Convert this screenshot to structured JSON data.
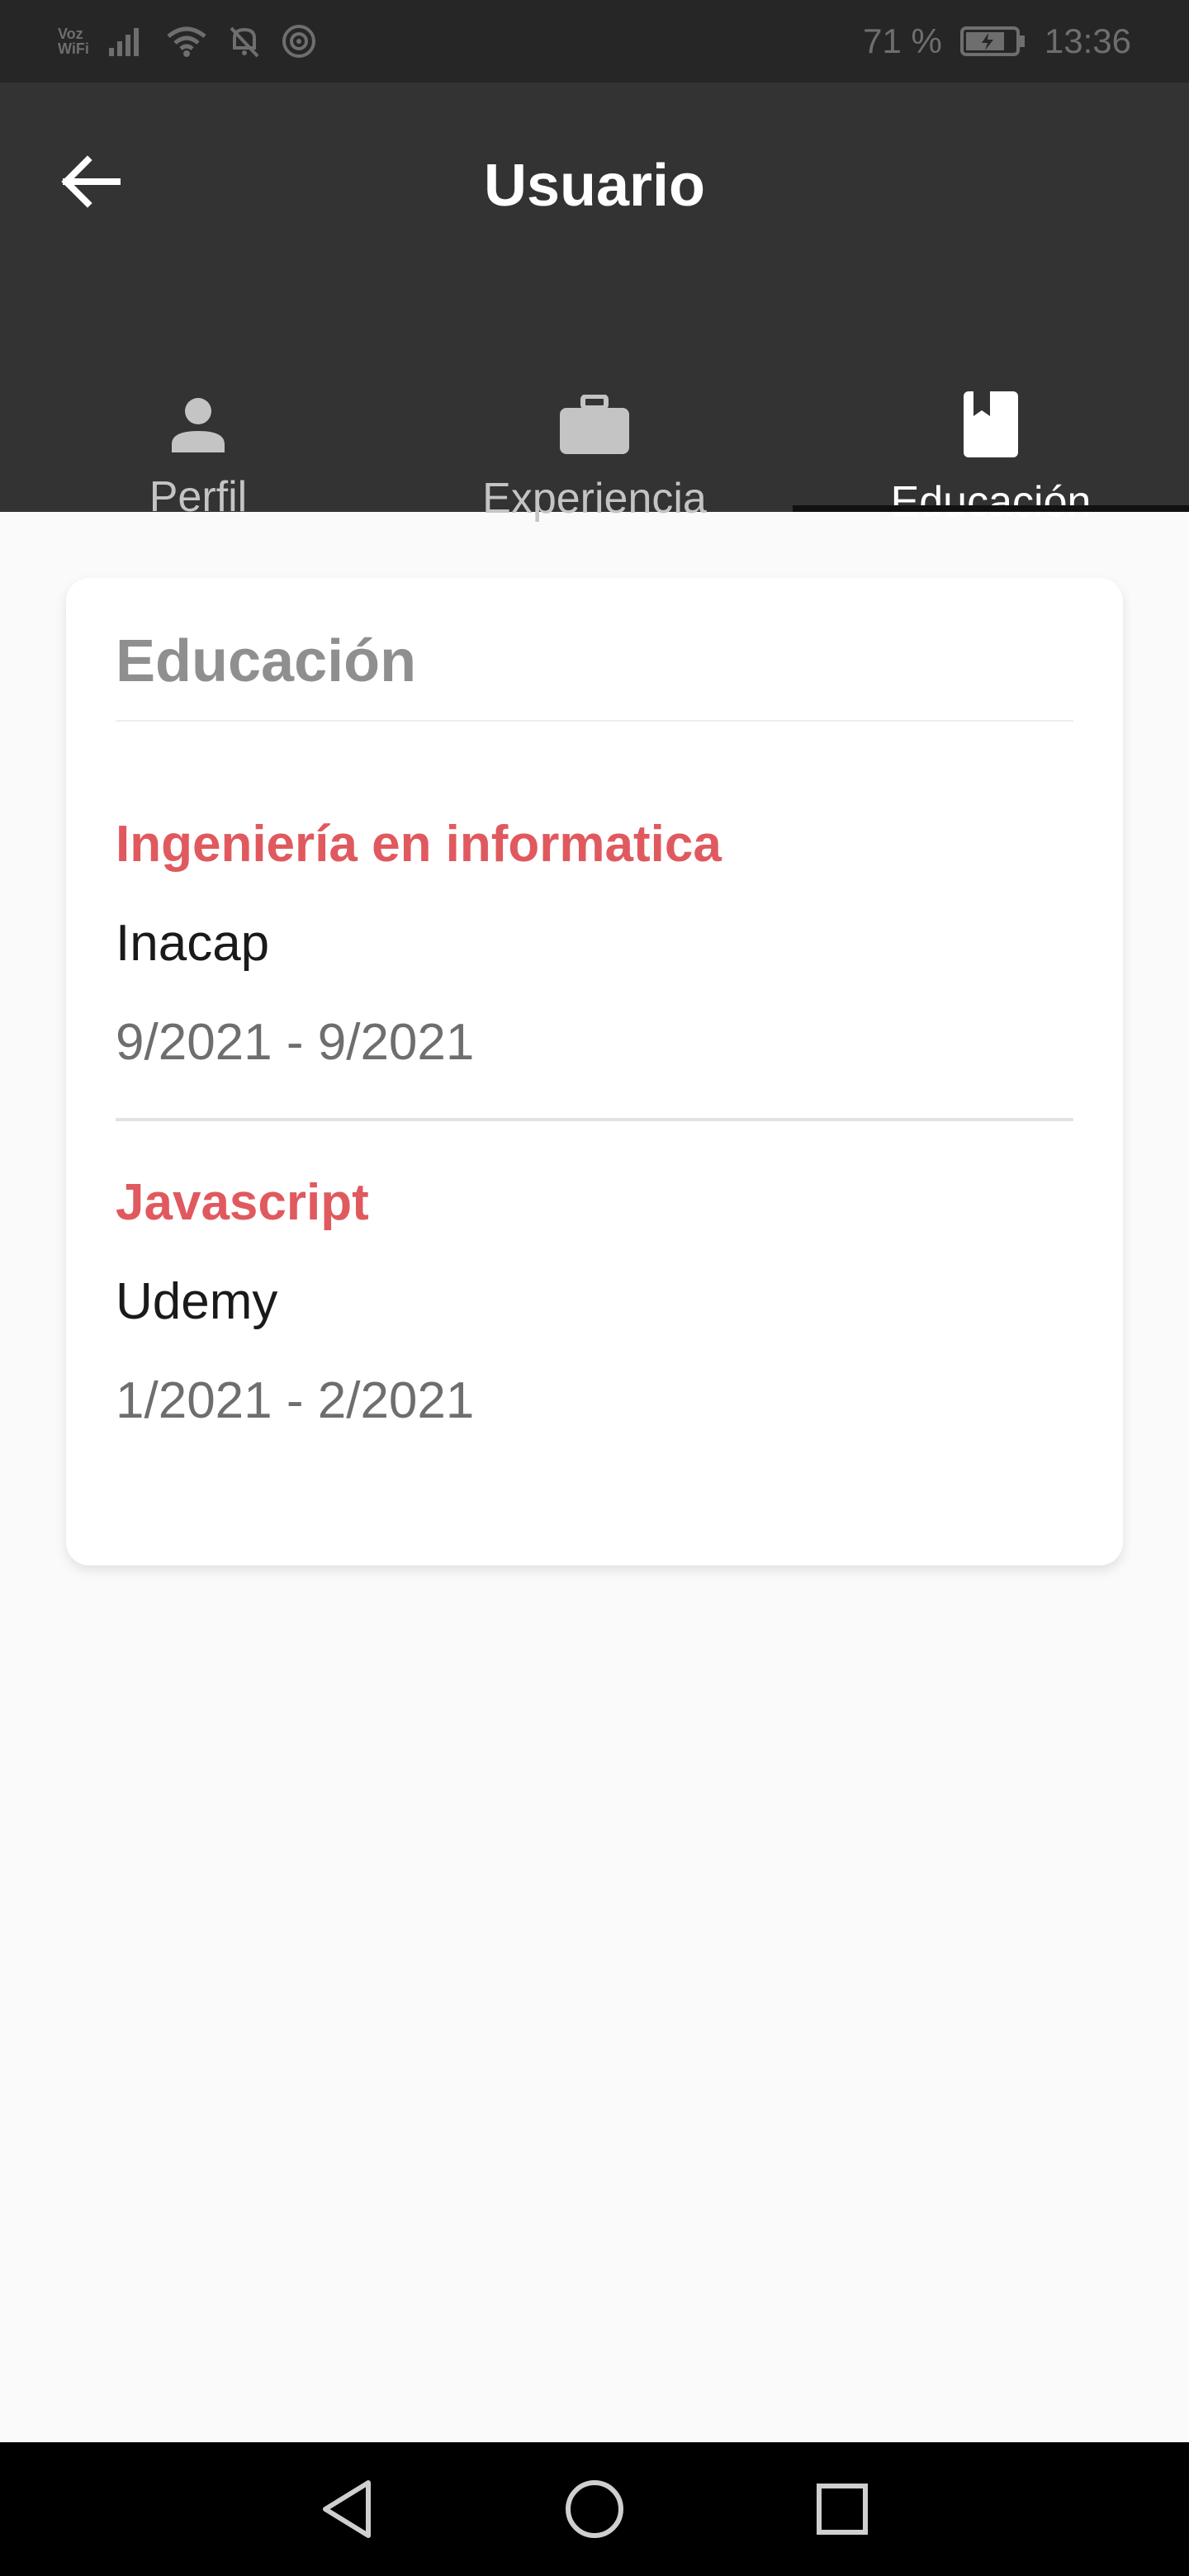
{
  "status_bar": {
    "network_label": "Voz\nWiFi",
    "battery_percent": "71 %",
    "time": "13:36",
    "icons": [
      "signal-icon",
      "wifi-icon",
      "mute-bell-icon",
      "hotspot-icon",
      "battery-icon"
    ]
  },
  "app_bar": {
    "title": "Usuario",
    "back_icon": "arrow-left-icon"
  },
  "tabs": [
    {
      "label": "Perfil",
      "icon": "person-icon",
      "active": false
    },
    {
      "label": "Experiencia",
      "icon": "briefcase-icon",
      "active": false
    },
    {
      "label": "Educación",
      "icon": "bookmark-book-icon",
      "active": true
    }
  ],
  "card": {
    "title": "Educación",
    "items": [
      {
        "degree": "Ingeniería en informatica",
        "school": "Inacap",
        "dates": "9/2021 - 9/2021"
      },
      {
        "degree": "Javascript",
        "school": "Udemy",
        "dates": "1/2021 - 2/2021"
      }
    ]
  },
  "nav_bar": {
    "buttons": [
      "back-triangle-icon",
      "home-circle-icon",
      "recents-square-icon"
    ]
  },
  "colors": {
    "app_bar": "#333333",
    "status_bar": "#262626",
    "accent_red": "#e0595e",
    "background": "#fafafa"
  }
}
